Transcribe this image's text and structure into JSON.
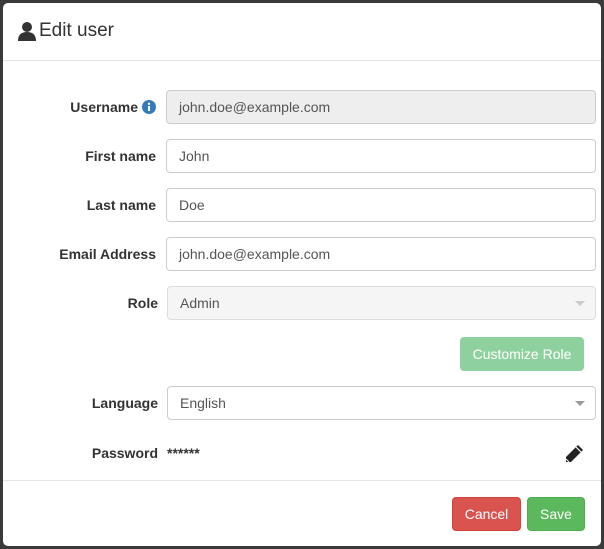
{
  "modal": {
    "title": "Edit user",
    "title_icon": "user-icon"
  },
  "form": {
    "username": {
      "label": "Username",
      "value": "john.doe@example.com",
      "info_icon": "info-circle-icon"
    },
    "first_name": {
      "label": "First name",
      "value": "John"
    },
    "last_name": {
      "label": "Last name",
      "value": "Doe"
    },
    "email": {
      "label": "Email Address",
      "value": "john.doe@example.com"
    },
    "role": {
      "label": "Role",
      "value": "Admin"
    },
    "customize_role": "Customize Role",
    "language": {
      "label": "Language",
      "value": "English"
    },
    "password": {
      "label": "Password",
      "value": "******",
      "edit_icon": "pencil-icon"
    }
  },
  "footer": {
    "cancel": "Cancel",
    "save": "Save"
  },
  "colors": {
    "info": "#337ab7",
    "success": "#5cb85c",
    "success_disabled": "#8fd19e",
    "danger": "#d9534f"
  }
}
